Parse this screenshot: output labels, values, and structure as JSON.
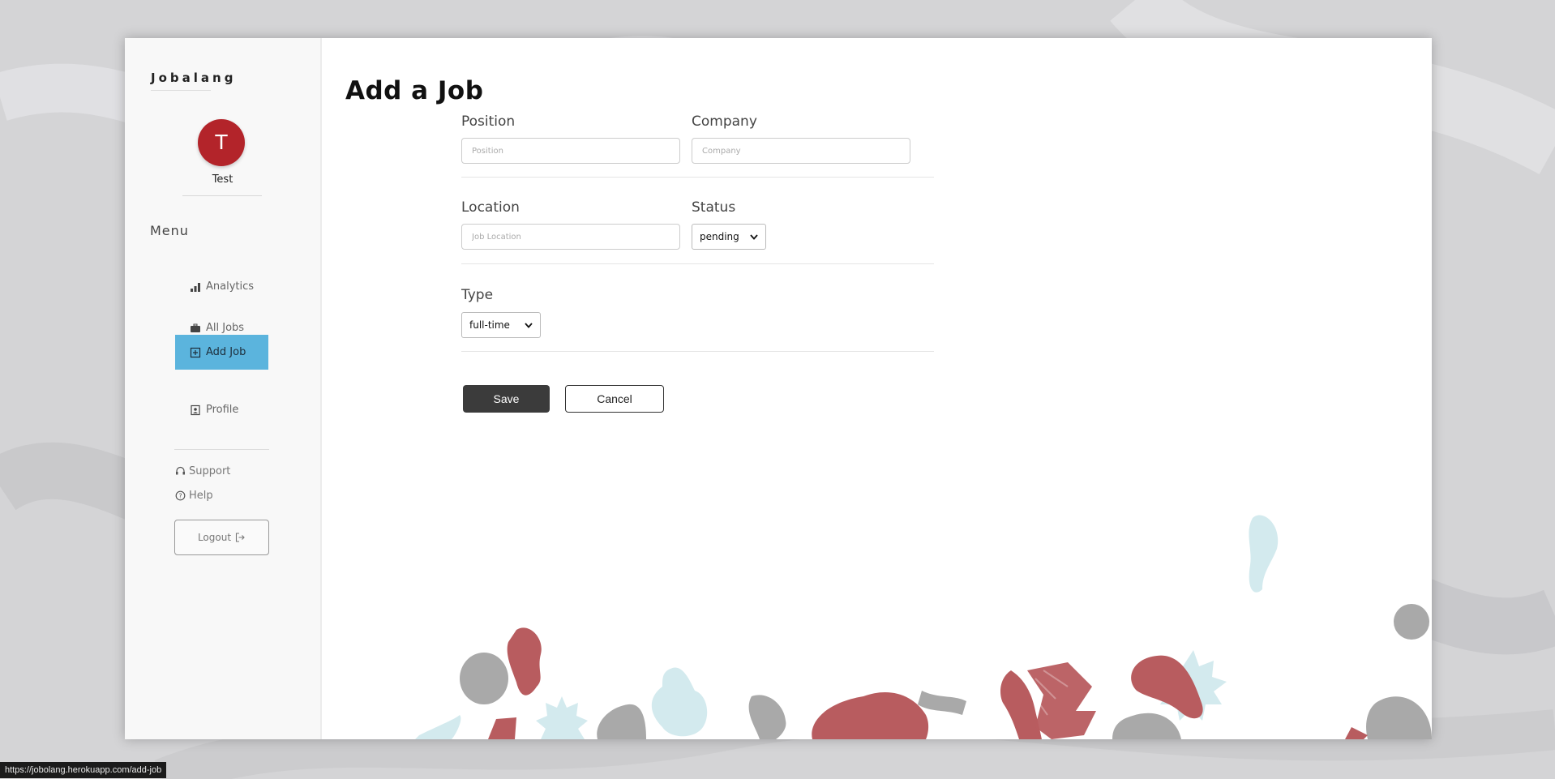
{
  "app": {
    "brand": "Jobalang"
  },
  "user": {
    "initial": "T",
    "name": "Test"
  },
  "sidebar": {
    "menu_title": "Menu",
    "items": [
      {
        "label": "Analytics",
        "icon": "bar-chart-icon",
        "active": false
      },
      {
        "label": "All Jobs",
        "icon": "briefcase-icon",
        "active": false
      },
      {
        "label": "Add Job",
        "icon": "plus-square-icon",
        "active": true
      },
      {
        "label": "Profile",
        "icon": "profile-card-icon",
        "active": false
      }
    ],
    "support": {
      "label": "Support",
      "icon": "headset-icon"
    },
    "help": {
      "label": "Help",
      "icon": "question-circle-icon"
    },
    "logout": {
      "label": "Logout",
      "icon": "logout-icon"
    }
  },
  "form": {
    "title": "Add a Job",
    "position": {
      "label": "Position",
      "placeholder": "Position",
      "value": ""
    },
    "company": {
      "label": "Company",
      "placeholder": "Company",
      "value": ""
    },
    "location": {
      "label": "Location",
      "placeholder": "Job Location",
      "value": ""
    },
    "status": {
      "label": "Status",
      "selected": "pending"
    },
    "type": {
      "label": "Type",
      "selected": "full-time"
    },
    "save_label": "Save",
    "cancel_label": "Cancel"
  },
  "browser": {
    "status_url": "https://jobolang.herokuapp.com/add-job"
  },
  "colors": {
    "accent": "#5bb4dd",
    "avatar": "#b3242a",
    "save_button": "#3b3b3b",
    "deco_red": "#b85c5f",
    "deco_gray": "#a9a9a9",
    "deco_teal": "#d3eaee"
  }
}
